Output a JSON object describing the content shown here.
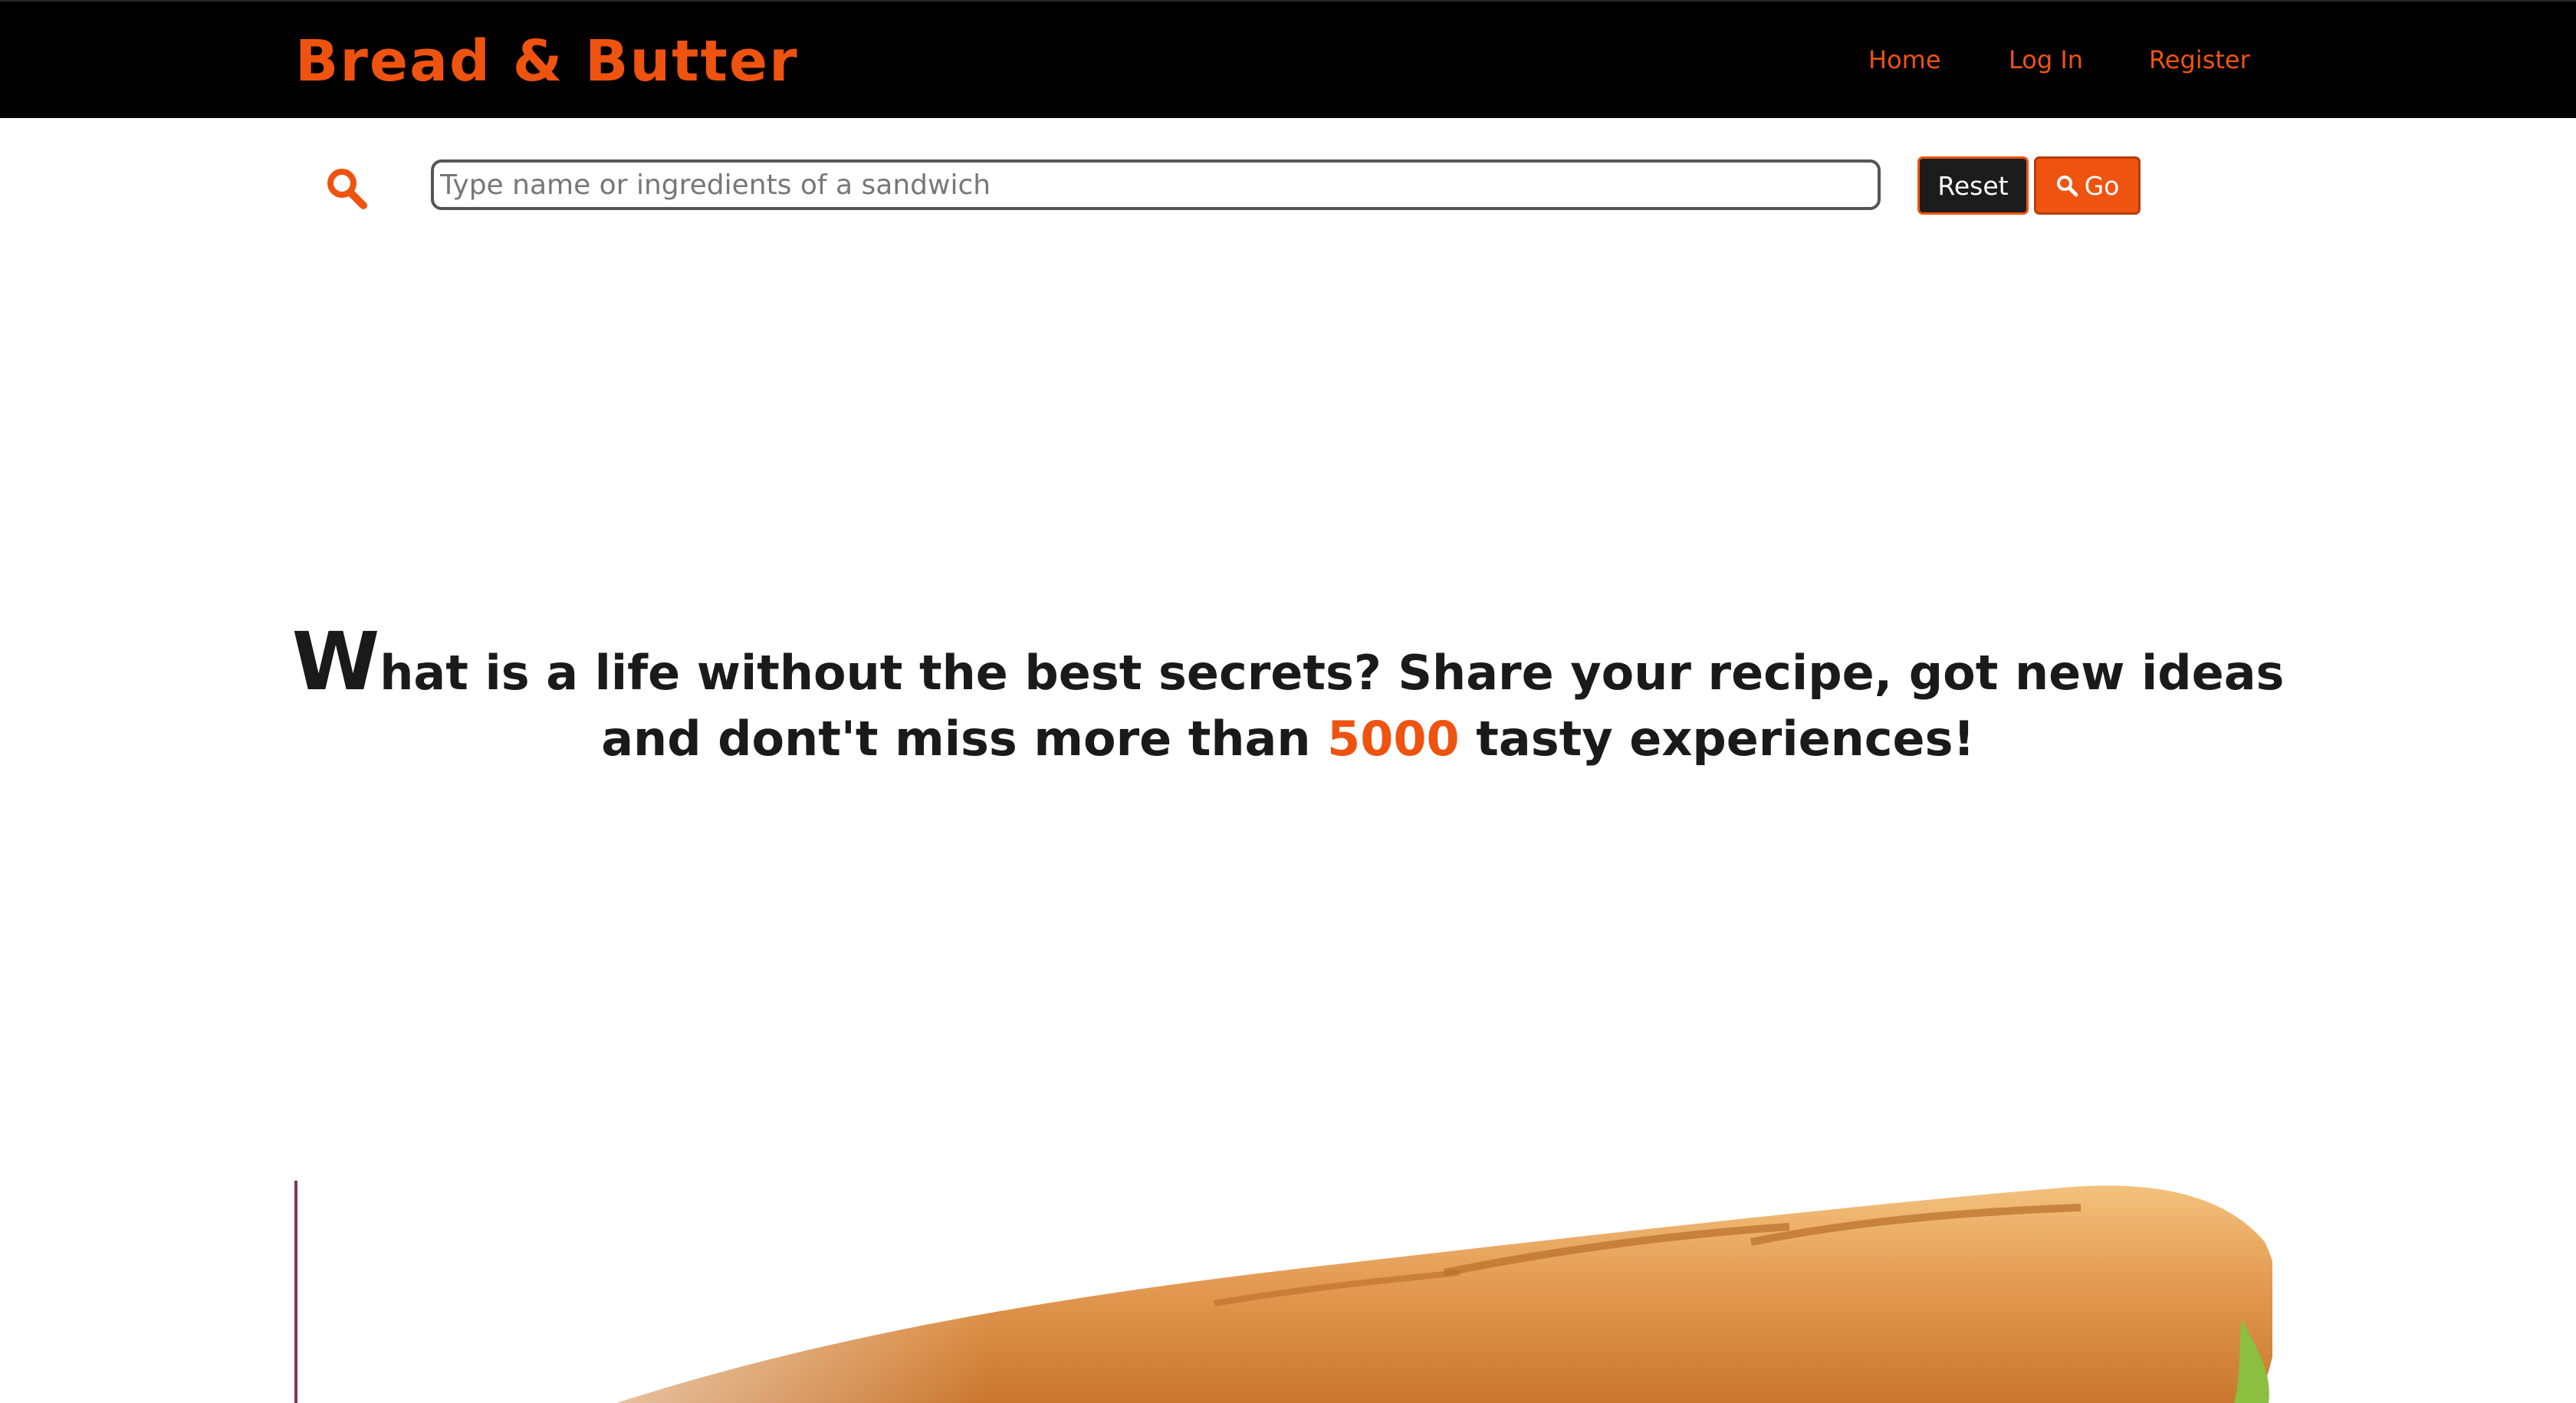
{
  "nav": {
    "brand": "Bread & Butter",
    "links": [
      "Home",
      "Log In",
      "Register"
    ]
  },
  "search": {
    "icon": "search-icon",
    "placeholder": "Type name or ingredients of a sandwich",
    "value": "",
    "reset_label": "Reset",
    "go_label": "Go",
    "go_icon": "search-icon"
  },
  "hero": {
    "dropcap": "W",
    "text_before": "hat is a life without the best secrets? Share your recipe, got new ideas and dont't miss more than ",
    "highlight": "5000",
    "text_after": " tasty experiences!"
  },
  "colors": {
    "accent": "#ef5310",
    "navbar_bg": "#000000",
    "text": "#1a1a1a"
  }
}
